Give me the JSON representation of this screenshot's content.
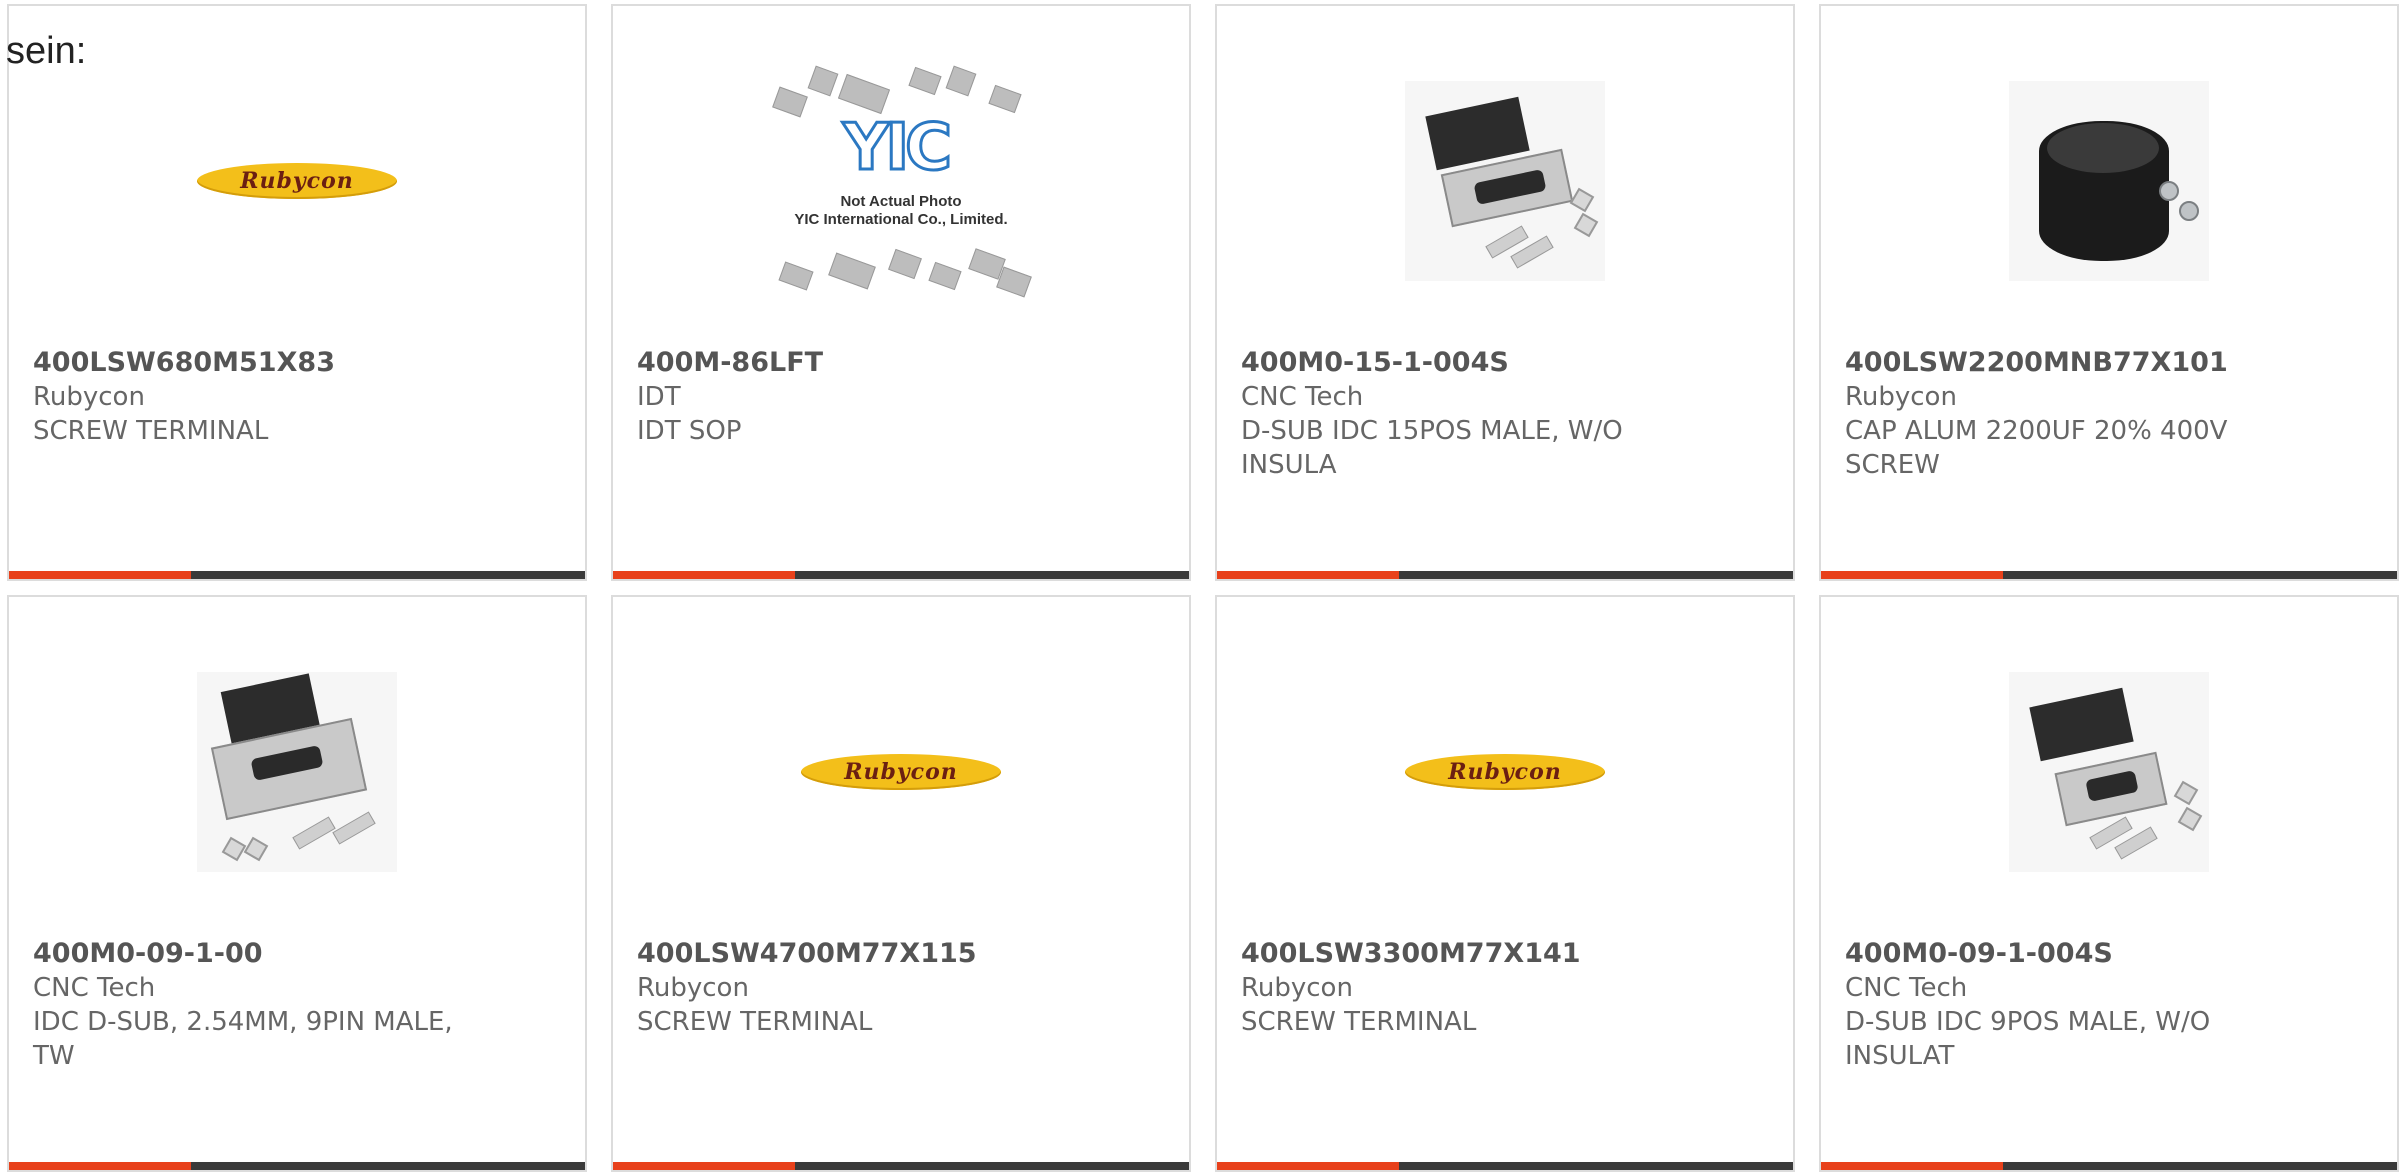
{
  "intro_text": "sein:",
  "placeholder": {
    "logo": "YIC",
    "line1": "Not Actual Photo",
    "line2": "YIC International Co., Limited."
  },
  "logo_text": "Rubycon",
  "products": [
    {
      "part_number": "400LSW680M51X83",
      "manufacturer": "Rubycon",
      "description": "SCREW TERMINAL",
      "image": "rubycon-logo"
    },
    {
      "part_number": "400M-86LFT",
      "manufacturer": "IDT",
      "description": "IDT SOP",
      "image": "not-actual-photo"
    },
    {
      "part_number": "400M0-15-1-004S",
      "manufacturer": "CNC Tech",
      "description": "D-SUB IDC 15POS MALE, W/O INSULA",
      "image": "dsub-connector-kit"
    },
    {
      "part_number": "400LSW2200MNB77X101",
      "manufacturer": "Rubycon",
      "description": "CAP ALUM 2200UF 20% 400V SCREW",
      "image": "electrolytic-capacitor"
    },
    {
      "part_number": "400M0-09-1-00",
      "manufacturer": "CNC Tech",
      "description": "IDC D-SUB, 2.54MM, 9PIN MALE, TW",
      "image": "dsub-connector"
    },
    {
      "part_number": "400LSW4700M77X115",
      "manufacturer": "Rubycon",
      "description": "SCREW TERMINAL",
      "image": "rubycon-logo"
    },
    {
      "part_number": "400LSW3300M77X141",
      "manufacturer": "Rubycon",
      "description": "SCREW TERMINAL",
      "image": "rubycon-logo"
    },
    {
      "part_number": "400M0-09-1-004S",
      "manufacturer": "CNC Tech",
      "description": "D-SUB IDC 9POS MALE, W/O INSULAT",
      "image": "dsub-connector-kit"
    }
  ],
  "colors": {
    "accent": "#e8411b",
    "bar": "#3a3a3a",
    "border": "#dcdcdc"
  }
}
